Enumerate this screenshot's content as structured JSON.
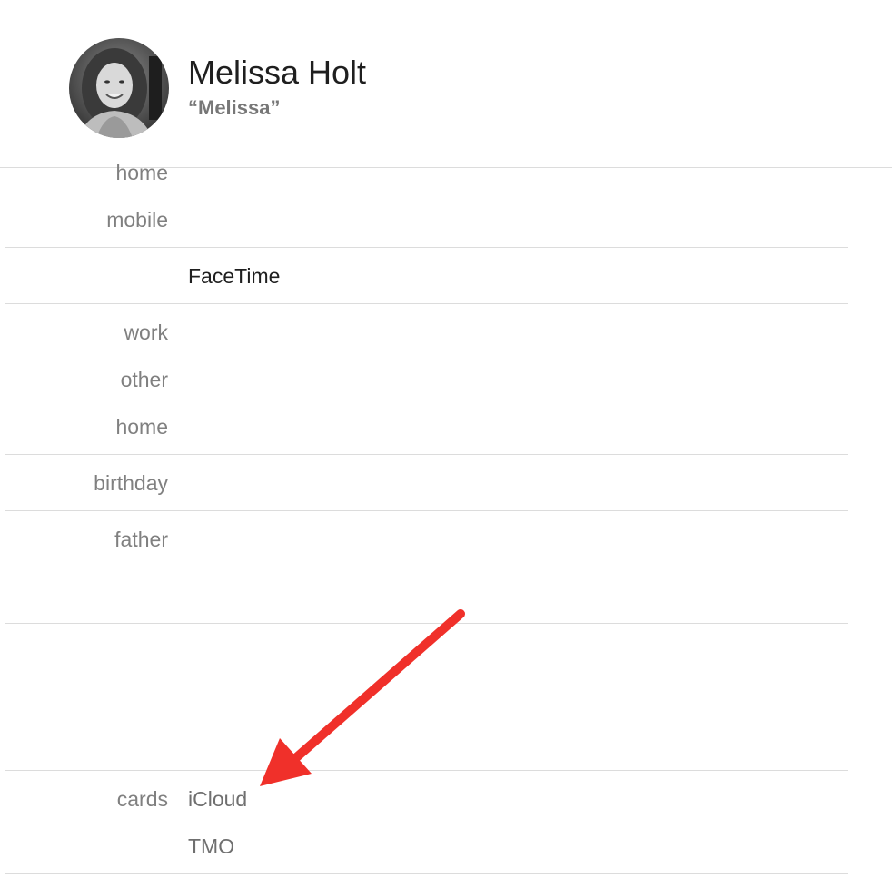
{
  "contact": {
    "name": "Melissa Holt",
    "nickname": "“Melissa”",
    "avatar_icon": "portrait-photo"
  },
  "phone": {
    "labels": [
      "home",
      "mobile"
    ]
  },
  "facetime": {
    "label": "FaceTime"
  },
  "email": {
    "labels": [
      "work",
      "other",
      "home"
    ]
  },
  "birthday": {
    "label": "birthday"
  },
  "related": {
    "label": "father"
  },
  "cards": {
    "label": "cards",
    "values": [
      "iCloud",
      "TMO"
    ]
  },
  "annotation": {
    "arrow_icon": "red-arrow-icon",
    "color": "#f0302a"
  },
  "colors": {
    "label": "#808080",
    "divider": "#dcdcdc",
    "name": "#1f1f1f"
  }
}
